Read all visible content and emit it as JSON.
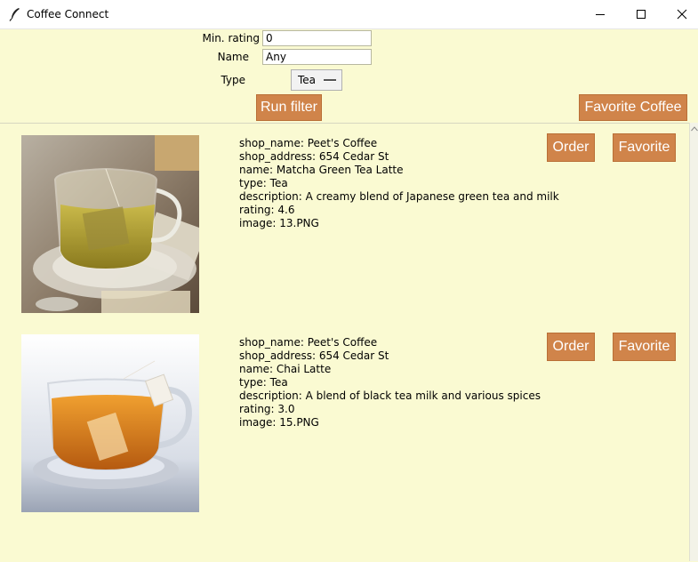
{
  "window": {
    "title": "Coffee Connect",
    "icons": [
      "feather-icon",
      "minimize-icon",
      "maximize-icon",
      "close-icon"
    ]
  },
  "filter": {
    "min_rating_label": "Min. rating",
    "min_rating_value": "0",
    "name_label": "Name",
    "name_value": "Any",
    "type_label": "Type",
    "type_selected": "Tea",
    "run_filter_label": "Run filter",
    "favorite_coffee_label": "Favorite Coffee"
  },
  "colors": {
    "background": "#fafad2",
    "button": "#d0844a",
    "button_text": "#ffffff"
  },
  "results": [
    {
      "lines": [
        "shop_name: Peet's Coffee",
        "shop_address: 654 Cedar St",
        "name: Matcha Green Tea Latte",
        "type: Tea",
        "description: A creamy blend of Japanese green tea and milk",
        "rating: 4.6",
        "image: 13.PNG"
      ],
      "order_label": "Order",
      "favorite_label": "Favorite",
      "image_subject": "glass cup of green tea with tea bag on saucer"
    },
    {
      "lines": [
        "shop_name: Peet's Coffee",
        "shop_address: 654 Cedar St",
        "name: Chai Latte",
        "type: Tea",
        "description: A blend of black tea milk and various spices",
        "rating: 3.0",
        "image: 15.PNG"
      ],
      "order_label": "Order",
      "favorite_label": "Favorite",
      "image_subject": "glass cup of amber tea with tea bag on saucer"
    }
  ]
}
